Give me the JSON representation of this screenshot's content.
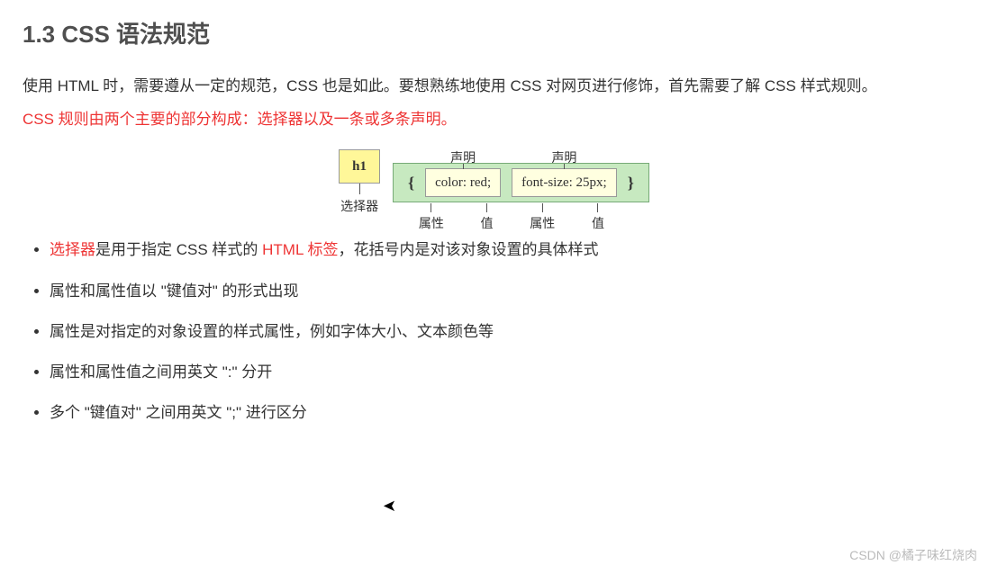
{
  "heading": "1.3 CSS 语法规范",
  "para1": "使用 HTML 时，需要遵从一定的规范，CSS 也是如此。要想熟练地使用 CSS 对网页进行修饰，首先需要了解 CSS 样式规则。",
  "para2": "CSS 规则由两个主要的部分构成：选择器以及一条或多条声明。",
  "diagram": {
    "selector": "h1",
    "selector_label": "选择器",
    "brace_open": "{",
    "brace_close": "}",
    "decl1": "color: red;",
    "decl2": "font-size: 25px;",
    "top_label": "声明",
    "prop_label": "属性",
    "val_label": "值"
  },
  "bullets": {
    "b1_a": "选择器",
    "b1_b": "是用于指定 CSS 样式的 ",
    "b1_c": "HTML 标签",
    "b1_d": "，花括号内是对该对象设置的具体样式",
    "b2": "属性和属性值以 \"键值对\" 的形式出现",
    "b3": "属性是对指定的对象设置的样式属性，例如字体大小、文本颜色等",
    "b4": "属性和属性值之间用英文 \":\" 分开",
    "b5": "多个 \"键值对\" 之间用英文 \";\" 进行区分"
  },
  "watermark": "CSDN @橘子味红烧肉"
}
